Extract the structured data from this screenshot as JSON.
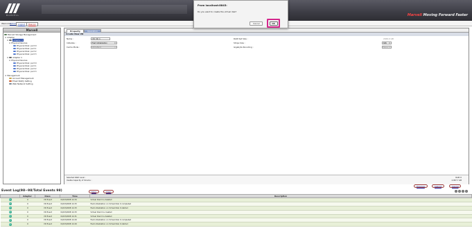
{
  "header": {
    "logo_text": "MARVELL",
    "slogan_brand": "Marvell",
    "slogan_rest": "Moving Forward Faster"
  },
  "userbar": {
    "welcome": "Welcome,",
    "user": "Admin",
    "logout": "Logout",
    "rescan": "Rescan"
  },
  "tree": {
    "title": "Marvell",
    "items": [
      "Marvell Storage Management",
      "Adapter",
      "Adapter 0",
      "Physical Devices",
      "Physical Disk: port 0",
      "Physical Disk: port 1",
      "Physical Disk: port 2",
      "Physical Disk: port 3",
      "Adapter 1",
      "Physical Devices",
      "Physical Disk: port 0",
      "Physical Disk: port 1",
      "Physical Disk: port 2",
      "Physical Disk: port 3",
      "Management",
      "Account Management",
      "Email Notify Setting",
      "Web Network Setting"
    ]
  },
  "tabs": {
    "properties": "Property",
    "operation": "Operation"
  },
  "form": {
    "section": "Create New VD",
    "name_label": "Name :",
    "name_value": "VD_VD_1",
    "init_label": "Initialize :",
    "init_value": "Fast Initialization",
    "cache_label": "Cache Mode :",
    "cache_value": "WriteBack",
    "raid_label": "RAID Set Size :",
    "raid_value": "2049.0 GB",
    "stripe_label": "Stripe Size :",
    "stripe_value": "64K",
    "round_label": "Gigabyte Rounding :",
    "round_value": "None",
    "bottom_l1": "Selected RAID Level :",
    "bottom_l2": "Usable Capacity of Volume :",
    "bottom_r1": "RAID 0",
    "bottom_r2": "2,097.7 GB"
  },
  "actions": {
    "previous": "Previous",
    "submit": "Submit",
    "cancel": "Cancel"
  },
  "eventlog": {
    "title": "Event Log(98~98/Total Events 98)",
    "save": "Save",
    "clear": "Clear",
    "columns": [
      "",
      "Adapter",
      "Class",
      "Time",
      "Description"
    ],
    "rows": [
      [
        "0",
        "VD Event",
        "04/23/2008 14:34",
        "Virtual Disk 0 is deleted"
      ],
      [
        "0",
        "VD Event",
        "04/23/2008 14:33",
        "Fast initialization on Virtual Disk 0 completed"
      ],
      [
        "0",
        "VD Event",
        "04/23/2008 14:33",
        "Fast initialization on Virtual Disk 0 started"
      ],
      [
        "0",
        "VD Event",
        "04/23/2008 14:33",
        "Virtual Disk 0 is created"
      ],
      [
        "0",
        "VD Event",
        "04/23/2008 14:31",
        "Virtual Disk 0 is deleted"
      ],
      [
        "0",
        "VD Event",
        "04/23/2008 14:29",
        "Fast initialization on Virtual Disk 0 completed"
      ],
      [
        "0",
        "VD Event",
        "04/23/2008 14:29",
        "Fast initialization on Virtual Disk 0 started"
      ]
    ]
  },
  "dialog": {
    "title": "From localhost:8845:",
    "message": "Do you want to create the virtual disk?",
    "cancel": "Cancel",
    "ok": "OK"
  },
  "colors": {
    "highlight": "#d4268c",
    "brand": "#ff4444"
  }
}
